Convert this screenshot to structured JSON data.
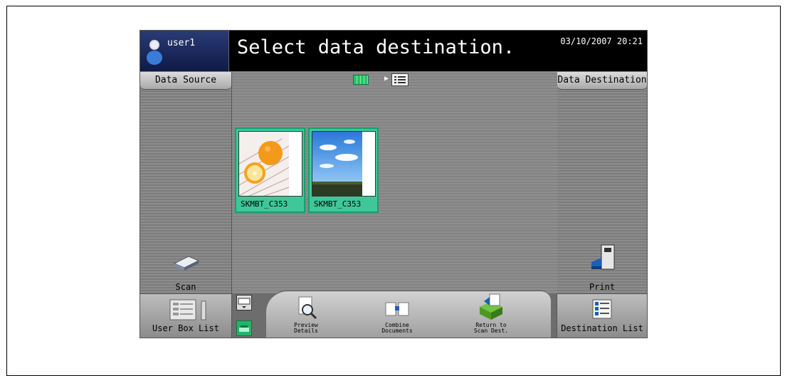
{
  "header": {
    "user": "user1",
    "prompt": "Select data destination.",
    "datetime": "03/10/2007 20:21"
  },
  "left_panel": {
    "title": "Data Source",
    "action_label": "Scan",
    "action_icon": "scanner-icon"
  },
  "right_panel": {
    "title": "Data Destination",
    "action_label": "Print",
    "action_icon": "printer-icon"
  },
  "view_toggle": {
    "selected": "thumbnail",
    "options": [
      "thumbnail-view-icon",
      "list-view-icon"
    ]
  },
  "files": [
    {
      "name": "SKMBT_C353",
      "thumbnail": "orange-photo"
    },
    {
      "name": "SKMBT_C353",
      "thumbnail": "sky-photo"
    }
  ],
  "bottom_bar": {
    "user_box_list": "User Box List",
    "destination_list": "Destination List",
    "preview_label_1": "Preview",
    "preview_label_2": "Details",
    "combine_label_1": "Combine",
    "combine_label_2": "Documents",
    "return_label_1": "Return to",
    "return_label_2": "Scan Dest."
  },
  "colors": {
    "header_bg": "#000000",
    "selected_card": "#3fc79a",
    "panel_bg": "#8a8a8a"
  }
}
